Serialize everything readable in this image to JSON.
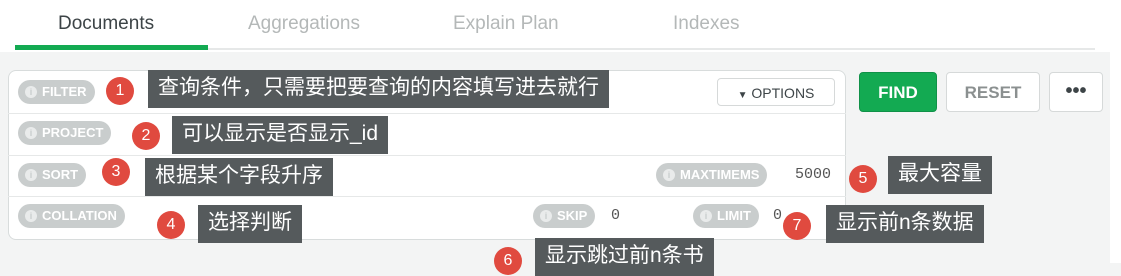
{
  "tabs": [
    {
      "label": "Documents",
      "active": true
    },
    {
      "label": "Aggregations",
      "active": false
    },
    {
      "label": "Explain Plan",
      "active": false
    },
    {
      "label": "Indexes",
      "active": false
    }
  ],
  "fields": {
    "filter": "FILTER",
    "project": "PROJECT",
    "sort": "SORT",
    "collation": "COLLATION",
    "maxtimems": "MAXTIMEMS",
    "maxtimems_value": "5000",
    "skip": "SKIP",
    "skip_value": "0",
    "limit": "LIMIT",
    "limit_value": "0"
  },
  "buttons": {
    "options": "OPTIONS",
    "find": "FIND",
    "reset": "RESET",
    "more": "•••"
  },
  "annotations": [
    {
      "num": "1",
      "text": "查询条件，只需要把要查询的内容填写进去就行"
    },
    {
      "num": "2",
      "text": "可以显示是否显示_id"
    },
    {
      "num": "3",
      "text": "根据某个字段升序"
    },
    {
      "num": "4",
      "text": "选择判断"
    },
    {
      "num": "5",
      "text": "最大容量"
    },
    {
      "num": "6",
      "text": "显示跳过前n条书"
    },
    {
      "num": "7",
      "text": "显示前n条数据"
    }
  ],
  "colors": {
    "accent": "#13aa52",
    "badge": "#e04a3f",
    "note_bg": "#555a5c"
  }
}
